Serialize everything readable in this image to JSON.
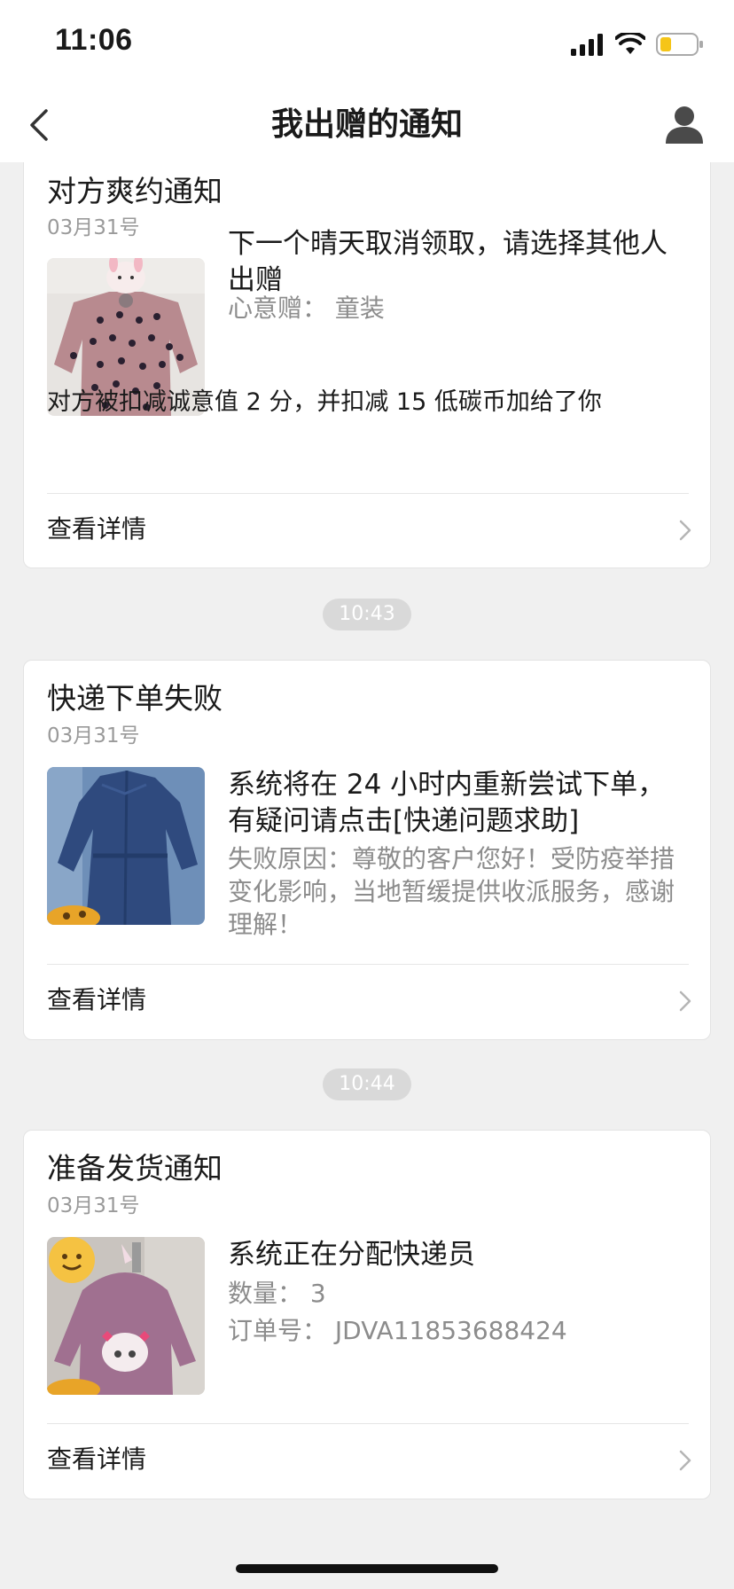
{
  "status_bar": {
    "time": "11:06"
  },
  "nav": {
    "title": "我出赠的通知"
  },
  "notifications": [
    {
      "title": "对方爽约通知",
      "date": "03月31号",
      "main_text": "下一个晴天取消领取，请选择其他人出赠",
      "sub_text": "心意赠： 童装",
      "extra_text": "对方被扣减诚意值 2 分，并扣减 15 低碳币加给了你",
      "detail_label": "查看详情",
      "thumb_icon": "pink-polka-dot-sweater"
    },
    {
      "title": "快递下单失败",
      "date": "03月31号",
      "main_text": "系统将在 24 小时内重新尝试下单，有疑问请点击[快递问题求助]",
      "sub_text": "失败原因：尊敬的客户您好！受防疫举措变化影响，当地暂缓提供收派服务，感谢理解！",
      "detail_label": "查看详情",
      "thumb_icon": "blue-denim-dress"
    },
    {
      "title": "准备发货通知",
      "date": "03月31号",
      "main_text": "系统正在分配快递员",
      "sub_lines": [
        "数量： 3",
        "订单号： JDVA11853688424"
      ],
      "detail_label": "查看详情",
      "thumb_icon": "purple-fleece-jacket"
    }
  ],
  "timestamps": [
    "10:43",
    "10:44"
  ],
  "colors": {
    "background": "#f0f0f0",
    "card": "#ffffff",
    "secondary_text": "#8c8c8c",
    "time_pill": "#d9d9d9"
  }
}
